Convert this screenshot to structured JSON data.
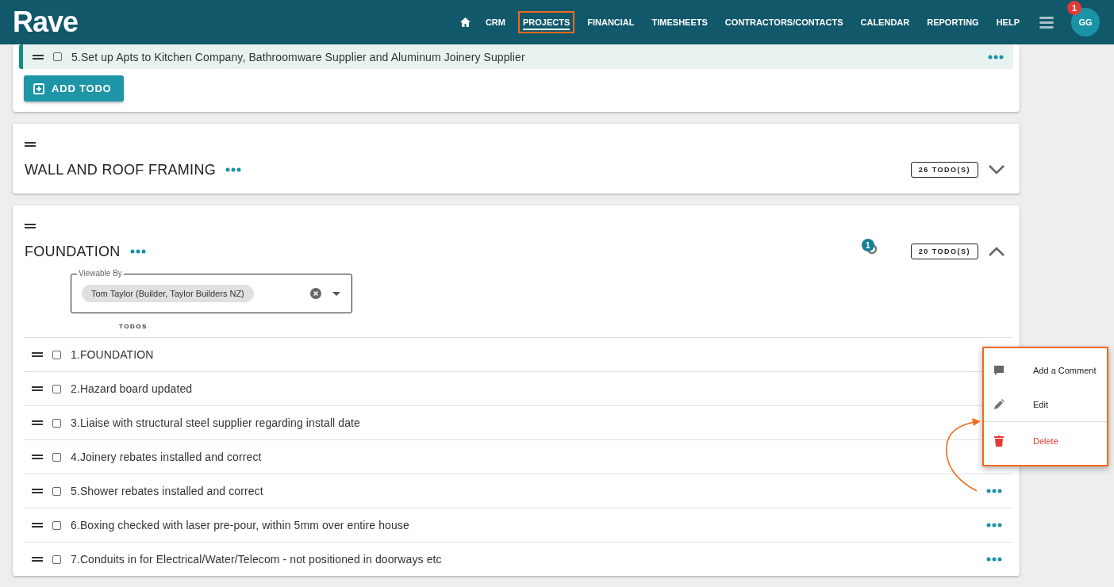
{
  "header": {
    "logo": "Rave",
    "nav": [
      {
        "label": "CRM",
        "selected": false,
        "highlighted": false
      },
      {
        "label": "PROJECTS",
        "selected": true,
        "highlighted": true
      },
      {
        "label": "FINANCIAL",
        "selected": false,
        "highlighted": false
      },
      {
        "label": "TIMESHEETS",
        "selected": false,
        "highlighted": false
      },
      {
        "label": "CONTRACTORS/CONTACTS",
        "selected": false,
        "highlighted": false
      },
      {
        "label": "CALENDAR",
        "selected": false,
        "highlighted": false
      },
      {
        "label": "REPORTING",
        "selected": false,
        "highlighted": false
      },
      {
        "label": "HELP",
        "selected": false,
        "highlighted": false
      }
    ],
    "notification_count": "1",
    "avatar": "GG"
  },
  "cards": [
    {
      "kind": "partial",
      "rows": [
        {
          "text": "5.Set up Apts to Kitchen Company, Bathroomware Supplier and Aluminum Joinery Supplier",
          "checked": false,
          "selected": true
        }
      ],
      "add_button": "ADD TODO"
    },
    {
      "kind": "collapsed",
      "title": "WALL AND ROOF FRAMING",
      "count": "26 TODO(S)",
      "expanded": false
    },
    {
      "kind": "expanded",
      "title": "FOUNDATION",
      "watch_count": "1",
      "count": "20 TODO(S)",
      "expanded": true,
      "viewable_by": {
        "label": "Viewable By",
        "chips": [
          "Tom Taylor (Builder, Taylor Builders NZ)"
        ]
      },
      "list_heading": "TODOS",
      "rows": [
        {
          "text": "1.FOUNDATION",
          "checked": false,
          "selected": false
        },
        {
          "text": "2.Hazard board updated",
          "checked": false,
          "selected": false
        },
        {
          "text": "3.Liaise with structural steel supplier regarding install date",
          "checked": false,
          "selected": false
        },
        {
          "text": "4.Joinery rebates installed and correct",
          "checked": false,
          "selected": false
        },
        {
          "text": "5.Shower rebates installed and correct",
          "checked": false,
          "selected": false
        },
        {
          "text": "6.Boxing checked with laser pre-pour, within 5mm over entire house",
          "checked": false,
          "selected": false
        },
        {
          "text": "7.Conduits in for Electrical/Water/Telecom - not positioned in doorways etc",
          "checked": false,
          "selected": false
        }
      ]
    }
  ],
  "context_menu": {
    "highlighted": true,
    "items": [
      {
        "kind": "comment",
        "label": "Add a Comment"
      },
      {
        "kind": "edit",
        "label": "Edit"
      },
      {
        "kind": "delete",
        "label": "Delete"
      }
    ]
  }
}
